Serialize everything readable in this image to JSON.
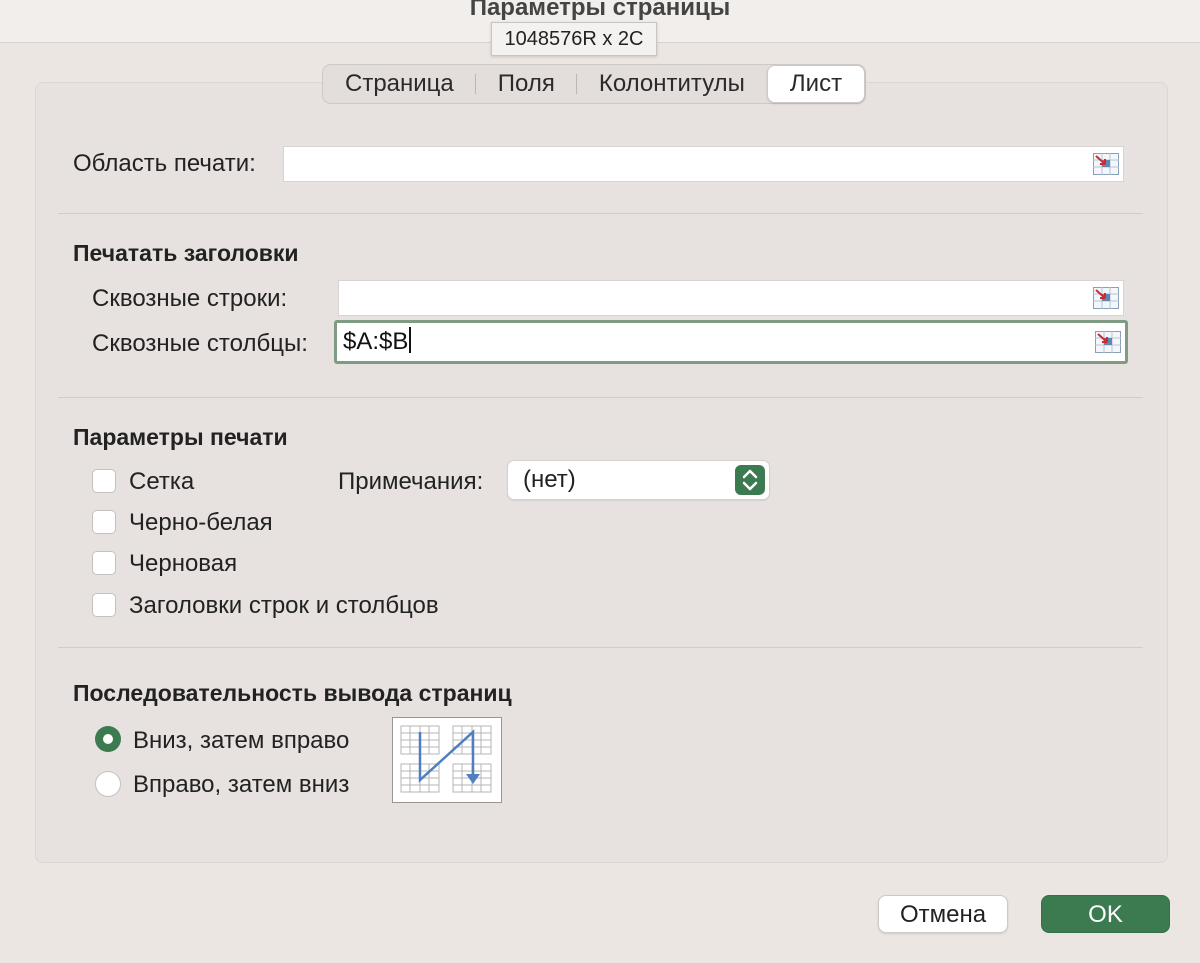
{
  "window": {
    "title": "Параметры страницы"
  },
  "tooltip": {
    "text": "1048576R x 2C"
  },
  "tabs": [
    {
      "label": "Страница",
      "active": false
    },
    {
      "label": "Поля",
      "active": false
    },
    {
      "label": "Колонтитулы",
      "active": false
    },
    {
      "label": "Лист",
      "active": true
    }
  ],
  "print_area": {
    "label": "Область печати:",
    "value": ""
  },
  "print_titles": {
    "heading": "Печатать заголовки",
    "rows_label": "Сквозные строки:",
    "rows_value": "",
    "cols_label": "Сквозные столбцы:",
    "cols_value": "$A:$B"
  },
  "print_options": {
    "heading": "Параметры печати",
    "checkboxes": [
      {
        "label": "Сетка",
        "checked": false
      },
      {
        "label": "Черно-белая",
        "checked": false
      },
      {
        "label": "Черновая",
        "checked": false
      },
      {
        "label": "Заголовки строк и столбцов",
        "checked": false
      }
    ],
    "comments_label": "Примечания:",
    "comments_value": "(нет)"
  },
  "page_order": {
    "heading": "Последовательность вывода страниц",
    "options": [
      {
        "label": "Вниз, затем вправо",
        "selected": true
      },
      {
        "label": "Вправо, затем вниз",
        "selected": false
      }
    ]
  },
  "buttons": {
    "cancel": "Отмена",
    "ok": "OK"
  },
  "colors": {
    "accent": "#3c7a50",
    "focus_ring": "#7f9b83",
    "background": "#ece6e3"
  }
}
